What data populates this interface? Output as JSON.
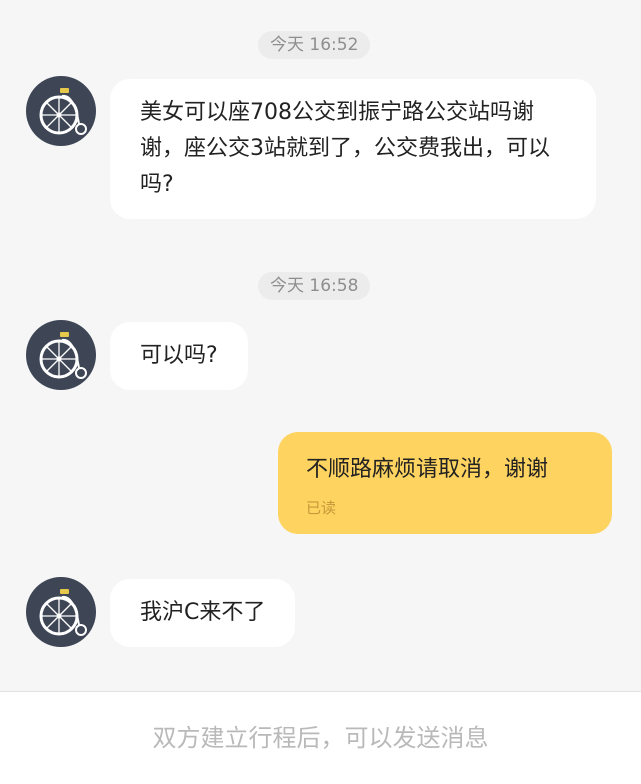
{
  "messages": [
    {
      "type": "timestamp",
      "text": "今天 16:52"
    },
    {
      "type": "incoming",
      "text": "美女可以座708公交到振宁路公交站吗谢谢，座公交3站就到了，公交费我出，可以吗?"
    },
    {
      "type": "timestamp",
      "text": "今天 16:58"
    },
    {
      "type": "incoming",
      "text": "可以吗?"
    },
    {
      "type": "outgoing",
      "text": "不顺路麻烦请取消，谢谢",
      "status": "已读"
    },
    {
      "type": "incoming",
      "text": "我沪C来不了"
    }
  ],
  "footer": {
    "notice": "双方建立行程后，可以发送消息"
  },
  "avatar": {
    "icon": "penny-farthing-bicycle-icon"
  },
  "colors": {
    "chat_background": "#f6f6f6",
    "incoming_bubble": "#ffffff",
    "outgoing_bubble": "#fed35f",
    "avatar_background": "#3e4656"
  }
}
